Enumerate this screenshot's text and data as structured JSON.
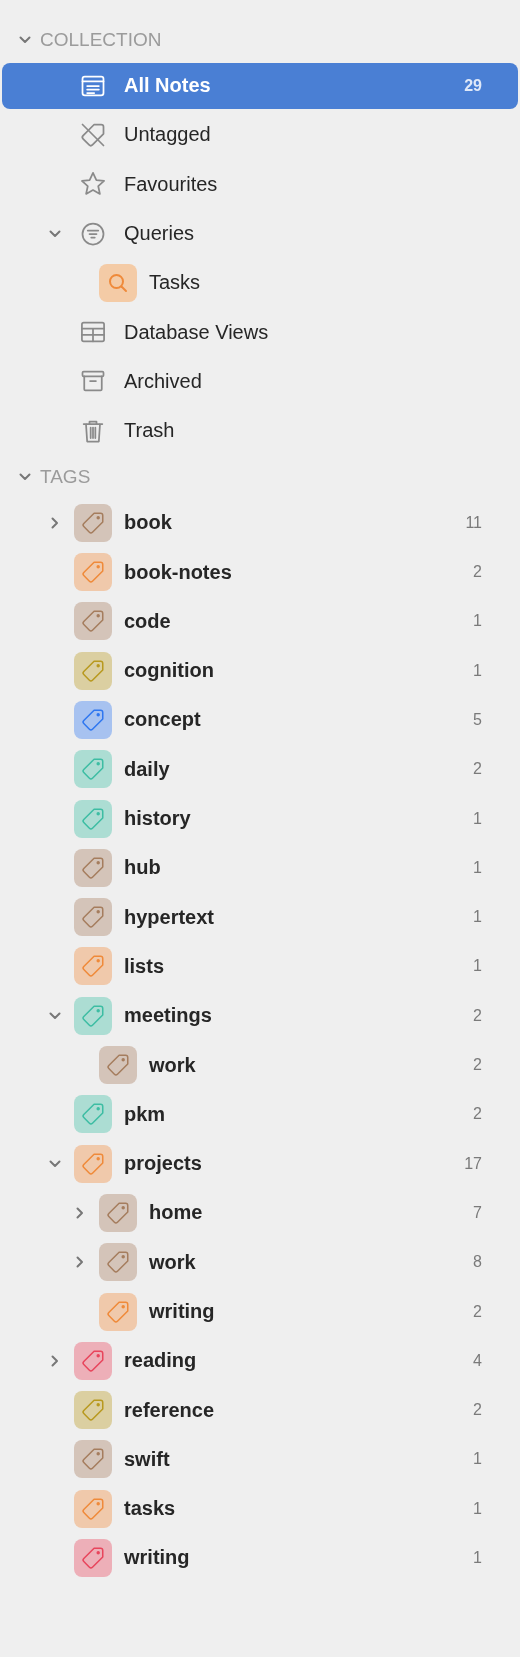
{
  "collection": {
    "label": "COLLECTION",
    "expanded": true,
    "items": [
      {
        "label": "All Notes",
        "kind": "notes",
        "selected": true,
        "count": "29"
      },
      {
        "label": "Untagged",
        "kind": "untagged",
        "selected": false
      },
      {
        "label": "Favourites",
        "kind": "star",
        "selected": false
      },
      {
        "label": "Queries",
        "kind": "filter",
        "selected": false,
        "expanded": true,
        "children": [
          {
            "label": "Tasks",
            "kind": "search",
            "selected": false
          }
        ]
      },
      {
        "label": "Database Views",
        "kind": "table",
        "selected": false
      },
      {
        "label": "Archived",
        "kind": "archive",
        "selected": false
      },
      {
        "label": "Trash",
        "kind": "trash",
        "selected": false
      }
    ]
  },
  "tags": {
    "label": "TAGS",
    "expanded": true,
    "items": [
      {
        "label": "book",
        "color": "#a57d5e",
        "count": "11",
        "selected": false,
        "expanded": false
      },
      {
        "label": "book-notes",
        "color": "#ef8a3a",
        "count": "2",
        "selected": false
      },
      {
        "label": "code",
        "color": "#a57d5e",
        "count": "1",
        "selected": false
      },
      {
        "label": "cognition",
        "color": "#b8991f",
        "count": "1",
        "selected": false
      },
      {
        "label": "concept",
        "color": "#2f77f0",
        "count": "5",
        "selected": false
      },
      {
        "label": "daily",
        "color": "#3dbda3",
        "count": "2",
        "selected": false
      },
      {
        "label": "history",
        "color": "#3dbda3",
        "count": "1",
        "selected": false
      },
      {
        "label": "hub",
        "color": "#a57d5e",
        "count": "1",
        "selected": false
      },
      {
        "label": "hypertext",
        "color": "#a57d5e",
        "count": "1",
        "selected": false
      },
      {
        "label": "lists",
        "color": "#ef8a3a",
        "count": "1",
        "selected": false
      },
      {
        "label": "meetings",
        "color": "#3dbda3",
        "count": "2",
        "selected": false,
        "expanded": true,
        "children": [
          {
            "label": "work",
            "color": "#a57d5e",
            "count": "2",
            "selected": false
          }
        ]
      },
      {
        "label": "pkm",
        "color": "#3dbda3",
        "count": "2",
        "selected": false
      },
      {
        "label": "projects",
        "color": "#ef8a3a",
        "count": "17",
        "selected": false,
        "expanded": true,
        "children": [
          {
            "label": "home",
            "color": "#a57d5e",
            "count": "7",
            "selected": false,
            "expanded": false
          },
          {
            "label": "work",
            "color": "#a57d5e",
            "count": "8",
            "selected": false,
            "expanded": false
          },
          {
            "label": "writing",
            "color": "#ef8a3a",
            "count": "2",
            "selected": false
          }
        ]
      },
      {
        "label": "reading",
        "color": "#e8455c",
        "count": "4",
        "selected": false,
        "expanded": false
      },
      {
        "label": "reference",
        "color": "#b8991f",
        "count": "2",
        "selected": false
      },
      {
        "label": "swift",
        "color": "#a57d5e",
        "count": "1",
        "selected": false
      },
      {
        "label": "tasks",
        "color": "#ef8a3a",
        "count": "1",
        "selected": false
      },
      {
        "label": "writing",
        "color": "#e8455c",
        "count": "1",
        "selected": false
      }
    ]
  }
}
